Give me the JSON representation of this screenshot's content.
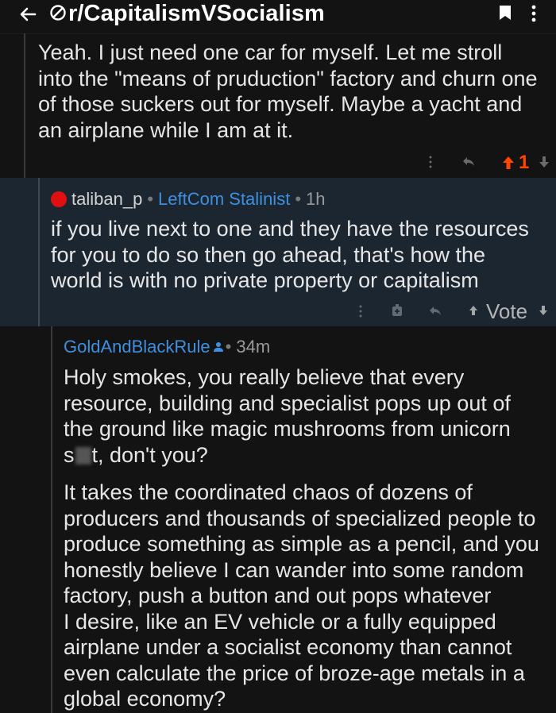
{
  "topbar": {
    "subreddit": "r/CapitalismVSocialism",
    "icons": [
      "back-arrow-icon",
      "subreddit-icon",
      "bookmark-icon",
      "more-vertical-icon"
    ]
  },
  "comments": [
    {
      "body": "Yeah. I just need one car for myself. Let me stroll\ninto the \"means of pruduction\" factory and churn one\nof those suckers out for myself. Maybe a yacht and\nan airplane while I am at it.",
      "score": "1",
      "vote_state": "upvoted"
    },
    {
      "username": "taliban_p",
      "flair": "LeftCom Stalinist",
      "time": "1h",
      "body": "if you live next to one and they have the resources\nfor you to do so then go ahead, that's how the\nworld is with no private property or capitalism",
      "vote_label": "Vote",
      "highlighted": true
    },
    {
      "username": "GoldAndBlackRule",
      "time": "34m",
      "body_p1_before": "Holy smokes, you really believe that every\nresource, building and specialist pops up out of\nthe ground like magic mushrooms from unicorn\ns",
      "body_p1_after": "t, don't you?",
      "body_p2": "It takes the coordinated chaos of dozens of\nproducers and thousands of specialized people to\nproduce something as simple as a pencil, and you\nhonestly believe I can wander into some random\nfactory, push a button and out pops whatever\nI desire, like an EV vehicle or a fully equipped\nairplane under a socialist economy than cannot\neven calculate the price of broze-age metals in a\nglobal economy?"
    }
  ],
  "colors": {
    "background": "#131313",
    "highlight": "#1c2630",
    "upvote": "#ff4500",
    "link_blue": "#3f8fe0",
    "online_dot": "#e01010"
  }
}
